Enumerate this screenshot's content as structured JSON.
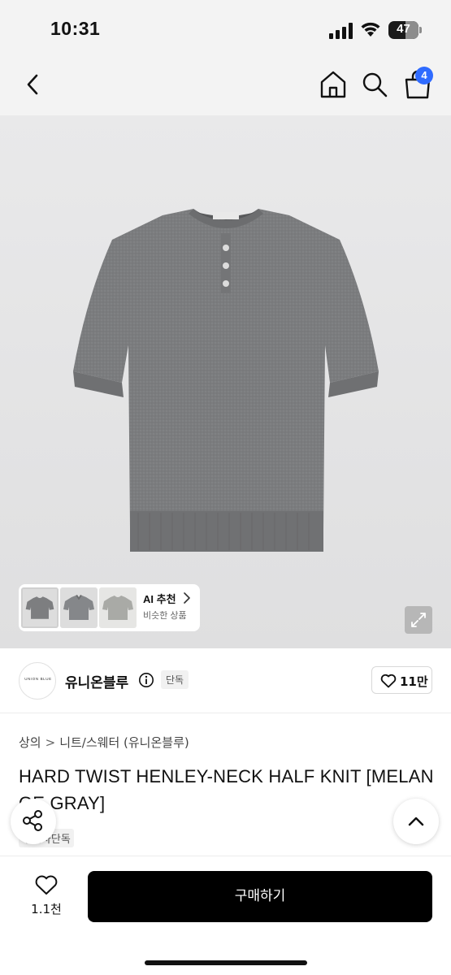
{
  "status_bar": {
    "time": "10:31",
    "battery_level": "47"
  },
  "nav": {
    "cart_count": "4"
  },
  "gallery": {
    "ai_title": "AI 추천",
    "ai_subtitle": "비슷한 상품"
  },
  "brand": {
    "logo_text": "UNION BLUE",
    "name": "유니온블루",
    "badge": "단독",
    "like_count": "11만"
  },
  "product": {
    "breadcrumb": [
      "상의",
      "니트/스웨터",
      "(유니온블루)"
    ],
    "breadcrumb_sep": ">",
    "title": "HARD TWIST HENLEY-NECK HALF KNIT [MELANGE GRAY]",
    "tag": "무신사단독"
  },
  "bottom": {
    "wish_count": "1.1천",
    "buy_label": "구매하기"
  },
  "colors": {
    "accent_badge": "#2f6bff",
    "buy_button": "#000000"
  }
}
